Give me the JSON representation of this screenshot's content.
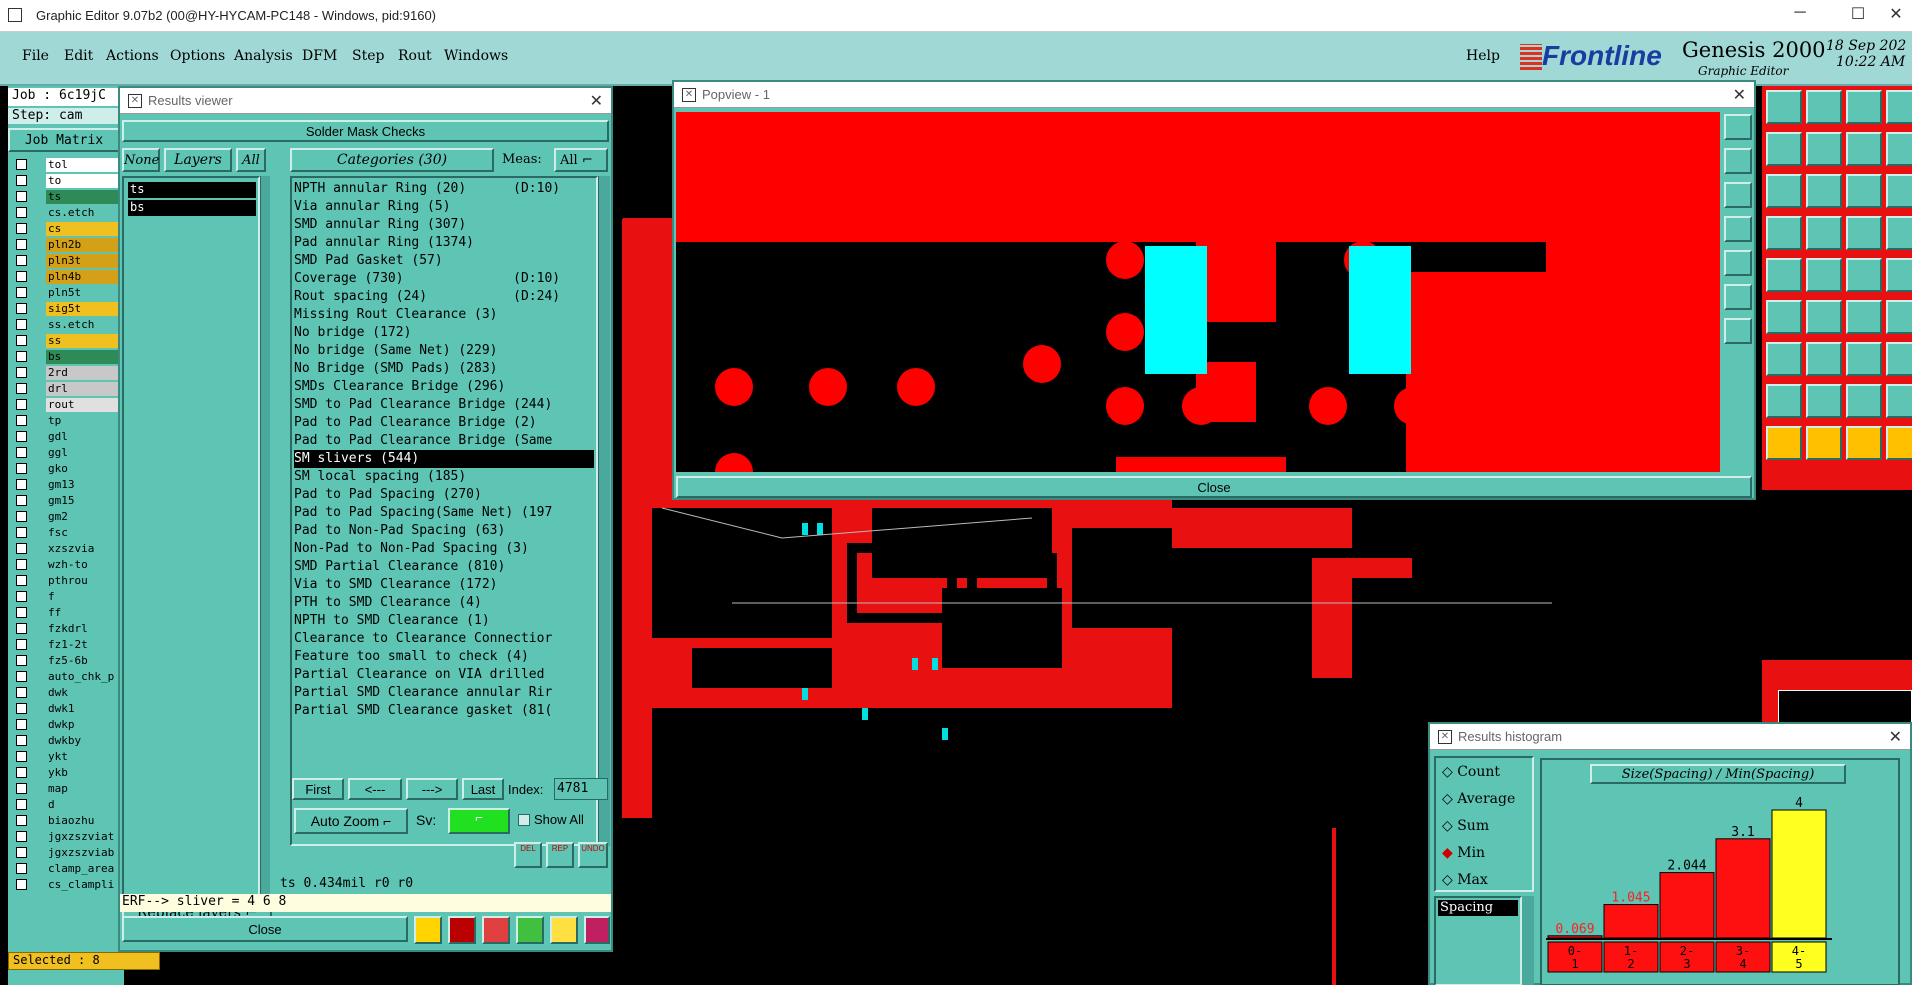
{
  "app_title": "Graphic Editor 9.07b2 (00@HY-HYCAM-PC148 - Windows, pid:9160)",
  "menu": [
    "File",
    "Edit",
    "Actions",
    "Options",
    "Analysis",
    "DFM",
    "Step",
    "Rout",
    "Windows"
  ],
  "help": "Help",
  "logo": {
    "brand": "Frontline",
    "product": "Genesis 2000",
    "subtitle": "Graphic Editor",
    "date": "18 Sep 202",
    "time": "10:22 AM"
  },
  "job": {
    "job_label": "Job : 6c19jC",
    "step_label": "Step: cam",
    "matrix_button": "Job Matrix",
    "selected": "Selected : 8"
  },
  "layers": [
    {
      "name": "tol",
      "color": "#ffffff"
    },
    {
      "name": "to",
      "color": "#ffffff"
    },
    {
      "name": "ts",
      "color": "#2e8b57"
    },
    {
      "name": "cs.etch",
      "color": "#5ec4b4"
    },
    {
      "name": "cs",
      "color": "#f0c020"
    },
    {
      "name": "pln2b",
      "color": "#d4a017"
    },
    {
      "name": "pln3t",
      "color": "#d4a017"
    },
    {
      "name": "pln4b",
      "color": "#d4a017"
    },
    {
      "name": "pln5t",
      "color": "#5ec4b4"
    },
    {
      "name": "sig5t",
      "color": "#f0c020"
    },
    {
      "name": "ss.etch",
      "color": "#5ec4b4"
    },
    {
      "name": "ss",
      "color": "#f0c020"
    },
    {
      "name": "bs",
      "color": "#2e8b57"
    },
    {
      "name": "2rd",
      "color": "#c8c8c8"
    },
    {
      "name": "drl",
      "color": "#c8c8c8"
    },
    {
      "name": "rout",
      "color": "#e0e0e0"
    },
    {
      "name": "tp",
      "color": "#5ec4b4"
    },
    {
      "name": "gdl",
      "color": "#5ec4b4"
    },
    {
      "name": "ggl",
      "color": "#5ec4b4"
    },
    {
      "name": "gko",
      "color": "#5ec4b4"
    },
    {
      "name": "gm13",
      "color": "#5ec4b4"
    },
    {
      "name": "gm15",
      "color": "#5ec4b4"
    },
    {
      "name": "gm2",
      "color": "#5ec4b4"
    },
    {
      "name": "fsc",
      "color": "#5ec4b4"
    },
    {
      "name": "xzszvia",
      "color": "#5ec4b4"
    },
    {
      "name": "wzh-to",
      "color": "#5ec4b4"
    },
    {
      "name": "pthrou",
      "color": "#5ec4b4"
    },
    {
      "name": "f",
      "color": "#5ec4b4"
    },
    {
      "name": "ff",
      "color": "#5ec4b4"
    },
    {
      "name": "fzkdrl",
      "color": "#5ec4b4"
    },
    {
      "name": "fz1-2t",
      "color": "#5ec4b4"
    },
    {
      "name": "fz5-6b",
      "color": "#5ec4b4"
    },
    {
      "name": "auto_chk_p",
      "color": "#5ec4b4"
    },
    {
      "name": "dwk",
      "color": "#5ec4b4"
    },
    {
      "name": "dwk1",
      "color": "#5ec4b4"
    },
    {
      "name": "dwkp",
      "color": "#5ec4b4"
    },
    {
      "name": "dwkby",
      "color": "#5ec4b4"
    },
    {
      "name": "ykt",
      "color": "#5ec4b4"
    },
    {
      "name": "ykb",
      "color": "#5ec4b4"
    },
    {
      "name": "map",
      "color": "#5ec4b4"
    },
    {
      "name": "d",
      "color": "#5ec4b4"
    },
    {
      "name": "biaozhu",
      "color": "#5ec4b4"
    },
    {
      "name": "jgxzszviat",
      "color": "#5ec4b4"
    },
    {
      "name": "jgxzszviab",
      "color": "#5ec4b4"
    },
    {
      "name": "clamp_area",
      "color": "#5ec4b4"
    },
    {
      "name": "cs_clampli",
      "color": "#5ec4b4"
    }
  ],
  "results_viewer": {
    "title": "Results viewer",
    "header": "Solder Mask Checks",
    "none_btn": "None",
    "layers_btn": "Layers",
    "all_btn": "All",
    "categories_btn": "Categories (30)",
    "meas_label": "Meas:",
    "meas_value": "All",
    "layer_list": [
      "ts",
      "bs"
    ],
    "categories": [
      "NPTH annular Ring (20)      (D:10)",
      "Via annular Ring (5)",
      "SMD annular Ring (307)",
      "Pad annular Ring (1374)",
      "SMD Pad Gasket (57)",
      "Coverage (730)              (D:10)",
      "Rout spacing (24)           (D:24)",
      "Missing Rout Clearance (3)",
      "No bridge (172)",
      "No bridge (Same Net) (229)",
      "No Bridge (SMD Pads) (283)",
      "SMDs Clearance Bridge (296)",
      "SMD to Pad Clearance Bridge (244)",
      "Pad to Pad Clearance Bridge (2)",
      "Pad to Pad Clearance Bridge (Same",
      "SM slivers (544)",
      "SM local spacing (185)",
      "Pad to Pad Spacing (270)",
      "Pad to Pad Spacing(Same Net) (197",
      "Pad to Non-Pad Spacing (63)",
      "Non-Pad to Non-Pad Spacing (3)",
      "SMD Partial Clearance (810)",
      "Via to SMD Clearance (172)",
      "PTH to SMD Clearance (4)",
      "NPTH to SMD Clearance (1)",
      "Clearance to Clearance Connectior",
      "Feature too small to check (4)",
      "Partial Clearance on VIA drilled",
      "Partial SMD Clearance annular Rir",
      "Partial SMD Clearance gasket (81("
    ],
    "selected_category": "SM slivers (544)",
    "first_btn": "First",
    "prev_btn": "<---",
    "next_btn": "--->",
    "last_btn": "Last",
    "index_label": "Index:",
    "index_value": "4781",
    "auto_zoom": "Auto Zoom",
    "sv_label": "Sv:",
    "show_all": "Show All",
    "replace_layers": "Replace layers",
    "status": "ts 0.434mil  r0  r0",
    "erf": "ERF--> sliver = 4 6 8",
    "close": "Close",
    "small_btns": [
      "DEL",
      "REP",
      "UNDO"
    ]
  },
  "popview": {
    "title": "Popview - 1",
    "close": "Close"
  },
  "histogram": {
    "title": "Results histogram",
    "options": [
      "Count",
      "Average",
      "Sum",
      "Min",
      "Max"
    ],
    "selected_option": "Min",
    "list_item": "Spacing",
    "chart_title": "Size(Spacing) / Min(Spacing)",
    "chart_data": {
      "type": "bar",
      "categories": [
        "0-1",
        "1-2",
        "2-3",
        "3-4",
        "4-5"
      ],
      "values": [
        0.069,
        1.045,
        2.044,
        3.1,
        4
      ],
      "labels": [
        "0.069",
        "1.045",
        "2.044",
        "3.1",
        "4"
      ],
      "highlight": "4-5",
      "colors": {
        "bar": "#ff1010",
        "highlight": "#ffff20"
      }
    }
  }
}
